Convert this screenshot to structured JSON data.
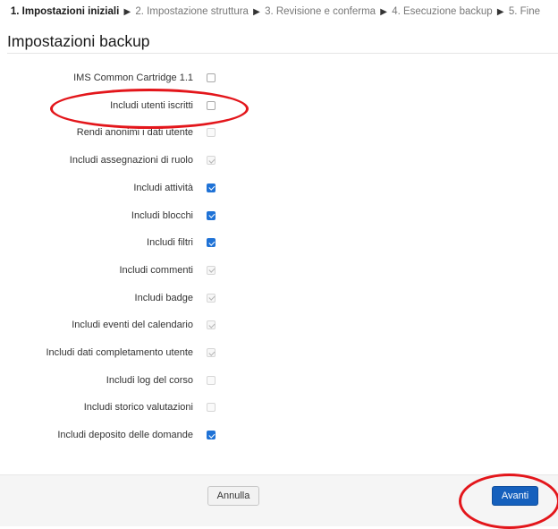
{
  "breadcrumb": {
    "steps": [
      {
        "label": "1. Impostazioni iniziali",
        "current": true
      },
      {
        "label": "2. Impostazione struttura",
        "current": false
      },
      {
        "label": "3. Revisione e conferma",
        "current": false
      },
      {
        "label": "4. Esecuzione backup",
        "current": false
      },
      {
        "label": "5. Fine",
        "current": false
      }
    ],
    "separator": "▶"
  },
  "page": {
    "title": "Impostazioni backup"
  },
  "settings": [
    {
      "label": "IMS Common Cartridge 1.1",
      "state": "unchecked"
    },
    {
      "label": "Includi utenti iscritti",
      "state": "unchecked"
    },
    {
      "label": "Rendi anonimi i dati utente",
      "state": "disabled"
    },
    {
      "label": "Includi assegnazioni di ruolo",
      "state": "locked-checked"
    },
    {
      "label": "Includi attività",
      "state": "checked"
    },
    {
      "label": "Includi blocchi",
      "state": "checked"
    },
    {
      "label": "Includi filtri",
      "state": "checked"
    },
    {
      "label": "Includi commenti",
      "state": "locked-checked"
    },
    {
      "label": "Includi badge",
      "state": "locked-checked"
    },
    {
      "label": "Includi eventi del calendario",
      "state": "locked-checked"
    },
    {
      "label": "Includi dati completamento utente",
      "state": "locked-checked"
    },
    {
      "label": "Includi log del corso",
      "state": "disabled"
    },
    {
      "label": "Includi storico valutazioni",
      "state": "disabled"
    },
    {
      "label": "Includi deposito delle domande",
      "state": "checked"
    }
  ],
  "footer": {
    "cancel_label": "Annulla",
    "next_label": "Avanti"
  },
  "colors": {
    "accent": "#1560bd",
    "annotation": "#e3161b"
  }
}
